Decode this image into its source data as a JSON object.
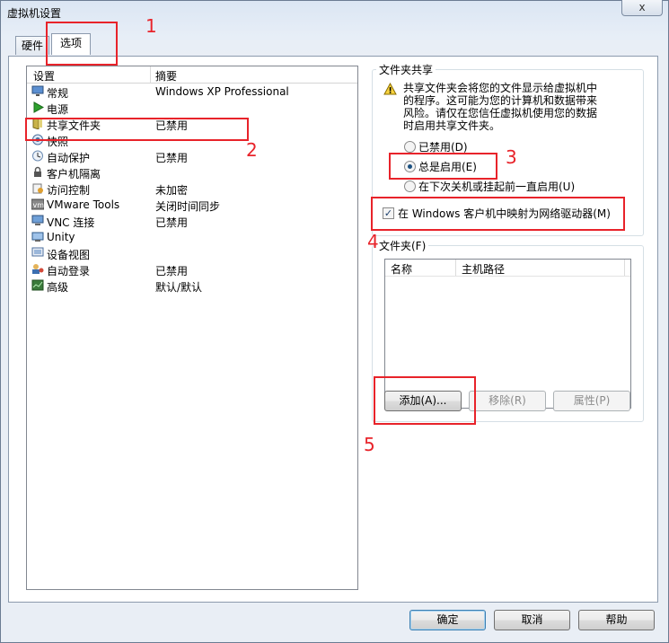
{
  "window": {
    "title": "虚拟机设置",
    "close_label": "x"
  },
  "tabs": [
    {
      "label": "硬件"
    },
    {
      "label": "选项"
    }
  ],
  "settings_list": {
    "columns": [
      "设置",
      "摘要"
    ],
    "rows": [
      {
        "name": "常规",
        "summary": "Windows XP Professional",
        "icon": "monitor-icon"
      },
      {
        "name": "电源",
        "summary": "",
        "icon": "play-icon"
      },
      {
        "name": "共享文件夹",
        "summary": "已禁用",
        "icon": "shared-folder-icon"
      },
      {
        "name": "快照",
        "summary": "",
        "icon": "snapshot-icon"
      },
      {
        "name": "自动保护",
        "summary": "已禁用",
        "icon": "autoprotect-icon"
      },
      {
        "name": "客户机隔离",
        "summary": "",
        "icon": "lock-icon"
      },
      {
        "name": "访问控制",
        "summary": "未加密",
        "icon": "access-control-icon"
      },
      {
        "name": "VMware Tools",
        "summary": "关闭时间同步",
        "icon": "vmware-tools-icon"
      },
      {
        "name": "VNC 连接",
        "summary": "已禁用",
        "icon": "vnc-icon"
      },
      {
        "name": "Unity",
        "summary": "",
        "icon": "unity-icon"
      },
      {
        "name": "设备视图",
        "summary": "",
        "icon": "device-view-icon"
      },
      {
        "name": "自动登录",
        "summary": "已禁用",
        "icon": "autologin-icon"
      },
      {
        "name": "高级",
        "summary": "默认/默认",
        "icon": "advanced-icon"
      }
    ]
  },
  "folder_sharing": {
    "group_label": "文件夹共享",
    "warning_lines": [
      "共享文件夹会将您的文件显示给虚拟机中",
      "的程序。这可能为您的计算机和数据带来",
      "风险。请仅在您信任虚拟机使用您的数据",
      "时启用共享文件夹。"
    ],
    "options": [
      {
        "label": "已禁用(D)",
        "selected": false
      },
      {
        "label": "总是启用(E)",
        "selected": true
      },
      {
        "label": "在下次关机或挂起前一直启用(U)",
        "selected": false
      }
    ],
    "map_drive": {
      "label": "在 Windows 客户机中映射为网络驱动器(M)",
      "checked": true
    }
  },
  "folders": {
    "group_label": "文件夹(F)",
    "columns": [
      "名称",
      "主机路径"
    ],
    "add_label": "添加(A)...",
    "remove_label": "移除(R)",
    "properties_label": "属性(P)"
  },
  "footer": {
    "ok_label": "确定",
    "cancel_label": "取消",
    "help_label": "帮助"
  },
  "annotations": [
    "1",
    "2",
    "3",
    "4",
    "5"
  ],
  "colors": {
    "annotation_red": "#e8232a",
    "window_frame": "#6b7c93",
    "radio_dot": "#1c5180"
  }
}
